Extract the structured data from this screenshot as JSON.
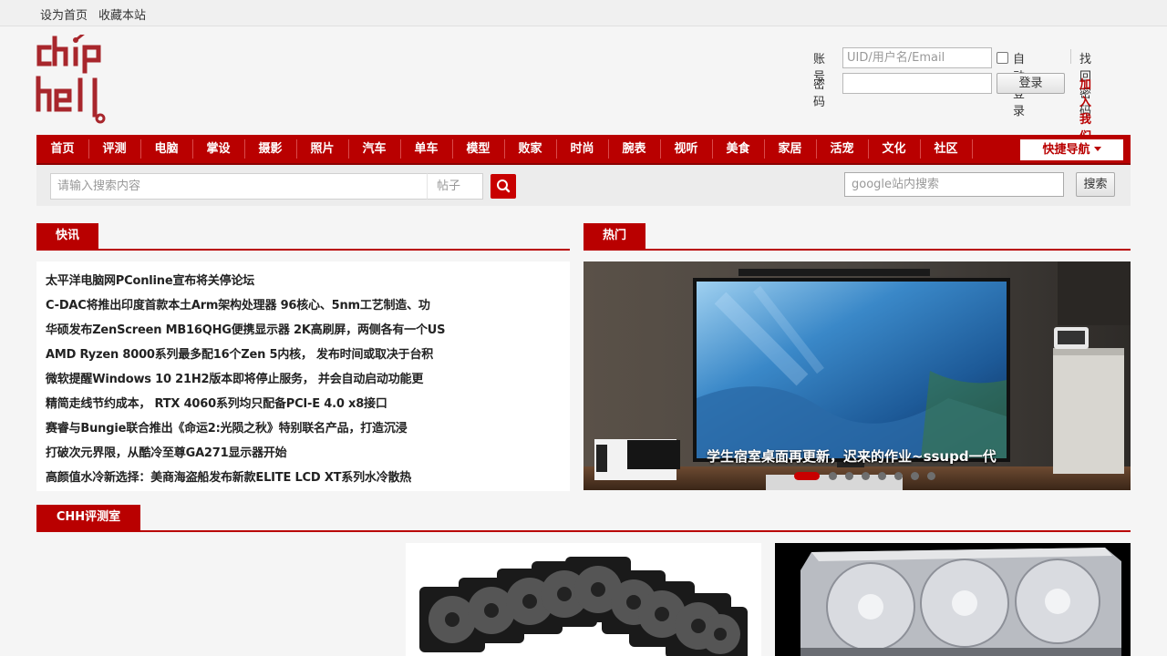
{
  "topbar": {
    "set_home": "设为首页",
    "bookmark": "收藏本站"
  },
  "login": {
    "account_label": "账号",
    "account_placeholder": "UID/用户名/Email",
    "auto_login_label": "自动登录",
    "recover_link": "找回密码",
    "password_label": "密码",
    "login_button": "登录",
    "join_link": "加入我们"
  },
  "colors": {
    "brand": "#b90000",
    "link": "#b90000"
  },
  "nav": {
    "items": [
      "首页",
      "评测",
      "电脑",
      "掌设",
      "摄影",
      "照片",
      "汽车",
      "单车",
      "模型",
      "败家",
      "时尚",
      "腕表",
      "视听",
      "美食",
      "家居",
      "活宠",
      "文化",
      "社区"
    ],
    "quick_nav": "快捷导航"
  },
  "search": {
    "placeholder": "请输入搜索内容",
    "type": "帖子",
    "search_icon": "search-icon",
    "google_placeholder": "google站内搜索",
    "google_button": "搜索"
  },
  "flash": {
    "title": "快讯",
    "items": [
      "太平洋电脑网PConline宣布将关停论坛",
      "C-DAC将推出印度首款本土Arm架构处理器 96核心、5nm工艺制造、功",
      "华硕发布ZenScreen MB16QHG便携显示器 2K高刷屏，两侧各有一个US",
      "AMD Ryzen 8000系列最多配16个Zen 5内核， 发布时间或取决于台积",
      "微软提醒Windows 10 21H2版本即将停止服务， 并会自动启动功能更",
      "精简走线节约成本， RTX 4060系列均只配备PCI-E 4.0 x8接口",
      "赛睿与Bungie联合推出《命运2:光陨之秋》特别联名产品，打造沉浸",
      "打破次元界限，从酷冷至尊GA271显示器开始",
      "高颜值水冷新选择：美商海盗船发布新款ELITE LCD XT系列水冷散热"
    ]
  },
  "hot": {
    "title": "热门",
    "caption": "学生宿室桌面再更新，迟来的作业~ssupd一代",
    "slide_count": 8,
    "active_slide": 1
  },
  "review": {
    "title": "CHH评测室"
  }
}
